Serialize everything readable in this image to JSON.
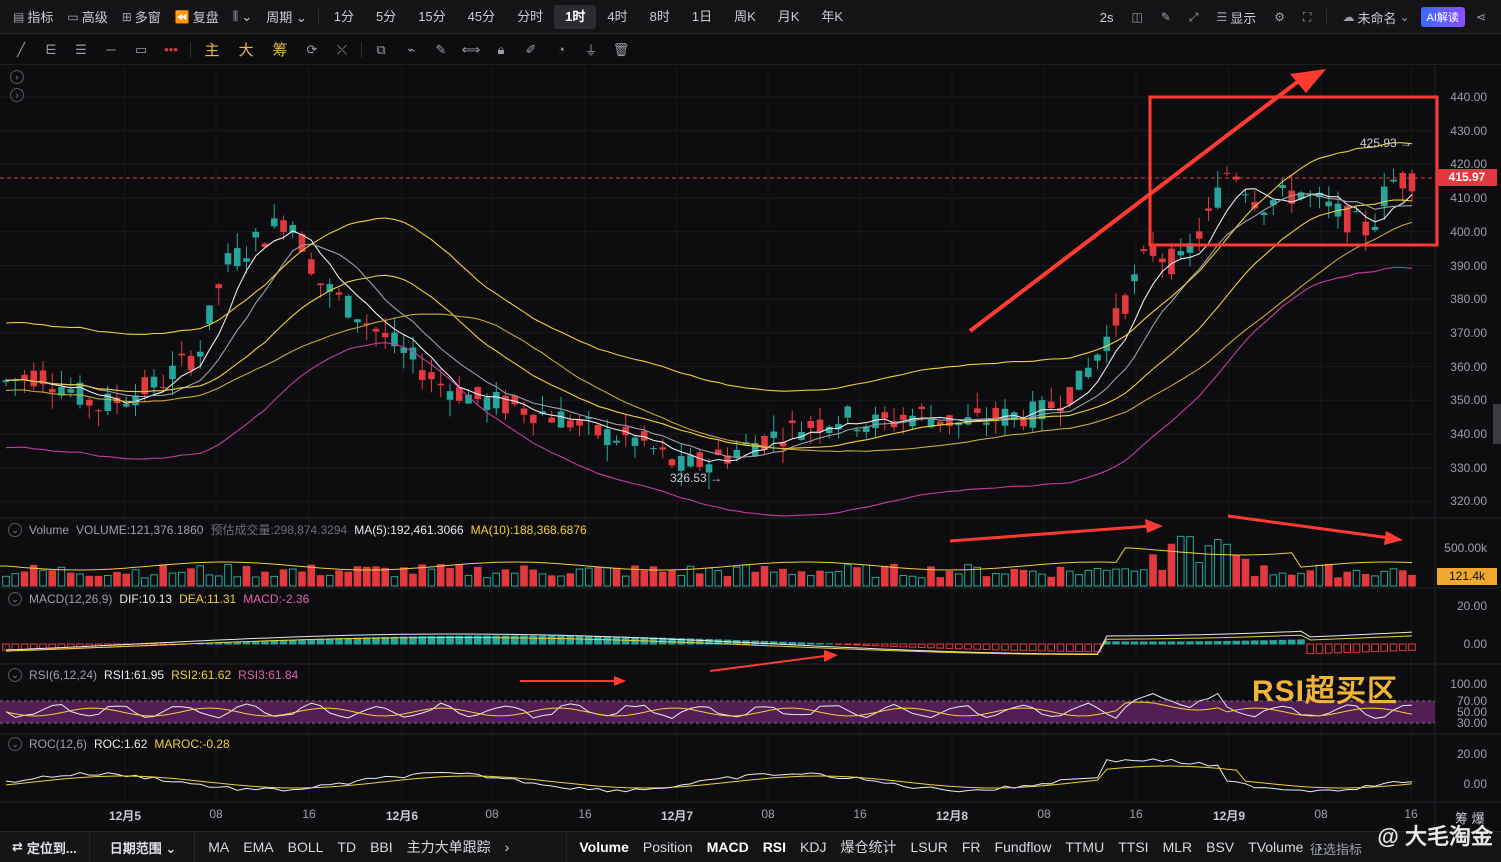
{
  "toolbar": {
    "left_items": [
      {
        "icon": "chart-icon",
        "label": "指标"
      },
      {
        "icon": "window-icon",
        "label": "高级"
      },
      {
        "icon": "grid-icon",
        "label": "多窗"
      },
      {
        "icon": "replay-icon",
        "label": "复盘"
      },
      {
        "icon": "candle-type-icon",
        "label": "⌄"
      },
      {
        "icon": "",
        "label": "周期 ⌄"
      }
    ],
    "periods": [
      "1分",
      "5分",
      "15分",
      "45分",
      "分时",
      "1时",
      "4时",
      "8时",
      "1日",
      "周K",
      "月K",
      "年K"
    ],
    "active_period": "1时",
    "right": {
      "refresh": "2s",
      "display_label": "显示",
      "layout_name": "未命名",
      "ai_label": "AI解读"
    }
  },
  "draw_toolbar": {
    "tools": [
      "line-tool-icon",
      "parallel-tool-icon",
      "channel-tool-icon",
      "horizontal-tool-icon",
      "rect-tool-icon",
      "more-tool-icon"
    ],
    "modes": [
      "主",
      "大",
      "筹"
    ],
    "actions": [
      "copy-icon",
      "ruler-icon",
      "pen-icon",
      "measure-icon",
      "lock-icon",
      "note-icon",
      "magnet-icon",
      "filter-icon",
      "trash-icon"
    ]
  },
  "price_axis": [
    "440.00",
    "430.00",
    "420.00",
    "410.00",
    "400.00",
    "390.00",
    "380.00",
    "370.00",
    "360.00",
    "350.00",
    "340.00",
    "330.00",
    "320.00"
  ],
  "current_price": "415.97",
  "high_marker": "425.93",
  "low_marker": "326.53",
  "volume": {
    "label": "Volume",
    "value": "VOLUME:121,376.1860",
    "predicted": "预估成交量:298,874.3294",
    "ma5": "MA(5):192,461.3066",
    "ma10": "MA(10):188,368.6876",
    "axis": "500.00k",
    "tag": "121.4k"
  },
  "macd": {
    "label": "MACD(12,26,9)",
    "dif": "DIF:10.13",
    "dea": "DEA:11.31",
    "macd": "MACD:-2.36",
    "axis": [
      "20.00",
      "0.00"
    ]
  },
  "rsi": {
    "label": "RSI(6,12,24)",
    "rsi1": "RSI1:61.95",
    "rsi2": "RSI2:61.62",
    "rsi3": "RSI3:61.84",
    "axis": [
      "100.00",
      "70.00",
      "50.00",
      "30.00"
    ],
    "annotation": "RSI超买区"
  },
  "roc": {
    "label": "ROC(12,6)",
    "roc": "ROC:1.62",
    "maroc": "MAROC:-0.28",
    "axis": [
      "20.00",
      "0.00"
    ]
  },
  "time_axis": [
    {
      "label": "12月5",
      "bold": true
    },
    {
      "label": "08",
      "bold": false
    },
    {
      "label": "16",
      "bold": false
    },
    {
      "label": "12月6",
      "bold": true
    },
    {
      "label": "08",
      "bold": false
    },
    {
      "label": "16",
      "bold": false
    },
    {
      "label": "12月7",
      "bold": true
    },
    {
      "label": "08",
      "bold": false
    },
    {
      "label": "16",
      "bold": false
    },
    {
      "label": "12月8",
      "bold": true
    },
    {
      "label": "08",
      "bold": false
    },
    {
      "label": "16",
      "bold": false
    },
    {
      "label": "12月9",
      "bold": true
    },
    {
      "label": "08",
      "bold": false
    },
    {
      "label": "16",
      "bold": false
    }
  ],
  "bottom_toolbar": {
    "locate": "定位到...",
    "date_range": "日期范围 ⌄",
    "main_indicators": [
      "MA",
      "EMA",
      "BOLL",
      "TD",
      "BBI",
      "主力大单跟踪",
      "›"
    ],
    "sub_indicators": [
      "Volume",
      "Position",
      "MACD",
      "RSI",
      "KDJ",
      "爆仓统计",
      "LSUR",
      "FR",
      "Fundflow",
      "TTMU",
      "TTSI",
      "MLR",
      "BSV",
      "TVolume",
      "›"
    ],
    "active_sub": [
      "Volume",
      "MACD",
      "RSI"
    ],
    "right_label": "征选指标"
  },
  "watermark": "@ 大毛淘金",
  "corner_text": "筹 爆",
  "colors": {
    "up": "#26a69a",
    "down": "#e1393f",
    "annotation": "#ff3b30",
    "rsi_zone": "#5b1f5e"
  }
}
